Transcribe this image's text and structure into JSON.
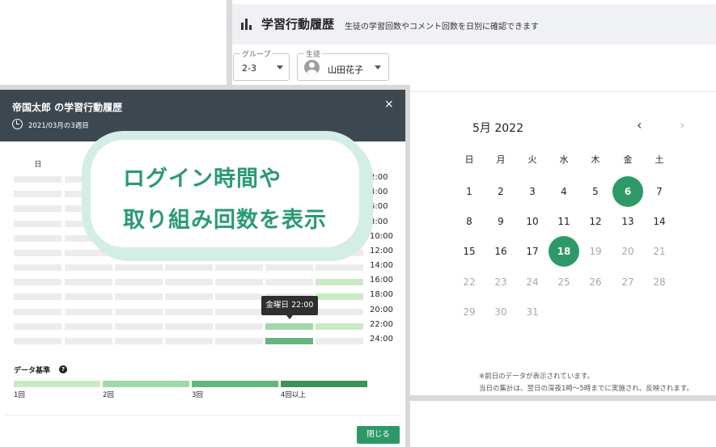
{
  "app": {
    "title": "学習行動履歴",
    "description": "生徒の学習回数やコメント回数を日別に確認できます",
    "group_label": "グループ",
    "group_value": "2-3",
    "student_label": "生徒",
    "student_value": "山田花子",
    "icons": {
      "chart": "bar-chart-icon",
      "avatar": "person-avatar-icon",
      "dropdown": "caret-down-icon"
    }
  },
  "calendar": {
    "month_label": "5月 2022",
    "prev": "‹",
    "next": "›",
    "weekdays": [
      "日",
      "月",
      "火",
      "水",
      "木",
      "金",
      "土"
    ],
    "weeks": [
      [
        "",
        "1",
        "2",
        "3",
        "4",
        "5",
        "6",
        "7"
      ],
      [
        "8",
        "9",
        "10",
        "11",
        "12",
        "13",
        "14"
      ],
      [
        "15",
        "16",
        "17",
        "18",
        "19",
        "20",
        "21"
      ],
      [
        "22",
        "23",
        "24",
        "25",
        "26",
        "27",
        "28"
      ],
      [
        "29",
        "30",
        "31"
      ]
    ],
    "highlighted_days": [
      "6",
      "18"
    ],
    "note_1": "※前日のデータが表示されています。",
    "note_2": "当日の集計は、翌日の深夜1時〜5時までに実施され、反映されます。"
  },
  "modal": {
    "title": "帝国太郎 の学習行動履歴",
    "close_glyph": "×",
    "week_label": "2021/03月の3週目",
    "weekday_header": "日",
    "hours": [
      "2:00",
      "4:00",
      "6:00",
      "8:00",
      "10:00",
      "12:00",
      "14:00",
      "16:00",
      "18:00",
      "20:00",
      "22:00",
      "24:00"
    ],
    "tooltip": "金曜日 22:00",
    "legend_title": "データ基準",
    "legend_help": "?",
    "legend": [
      "1回",
      "2回",
      "3回",
      "4回以上"
    ],
    "legend_colors": [
      "#c9ebc4",
      "#9fd9a8",
      "#66b57d",
      "#3f9156"
    ],
    "close_button": "閉じる"
  },
  "callout": {
    "line_1": "ログイン時間や",
    "line_2": "取り組み回数を表示"
  }
}
